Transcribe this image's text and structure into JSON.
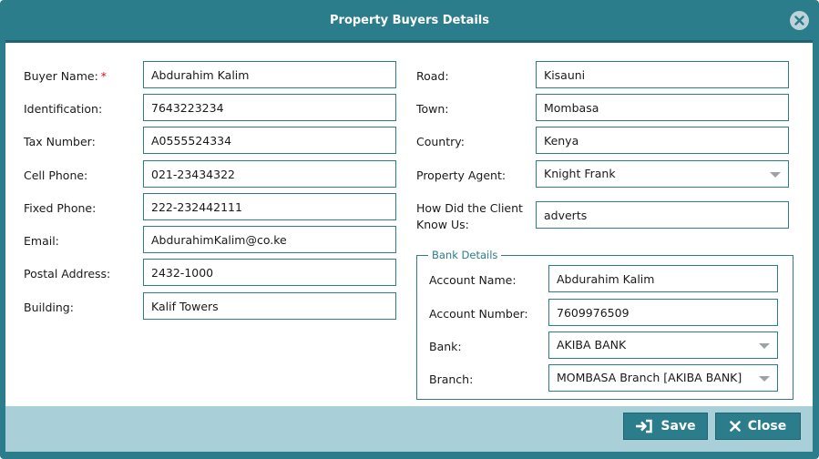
{
  "dialog": {
    "title": "Property Buyers Details",
    "close_icon": "close-circle-icon"
  },
  "left": {
    "buyer_name": {
      "label": "Buyer Name:",
      "required_mark": "*",
      "value": "Abdurahim Kalim"
    },
    "identification": {
      "label": "Identification:",
      "value": "7643223234"
    },
    "tax_number": {
      "label": "Tax Number:",
      "value": "A0555524334"
    },
    "cell_phone": {
      "label": "Cell Phone:",
      "value": "021-23434322"
    },
    "fixed_phone": {
      "label": "Fixed Phone:",
      "value": "222-232442111"
    },
    "email": {
      "label": "Email:",
      "value": "AbdurahimKalim@co.ke"
    },
    "postal_address": {
      "label": "Postal Address:",
      "value": "2432-1000"
    },
    "building": {
      "label": "Building:",
      "value": "Kalif Towers"
    }
  },
  "right": {
    "road": {
      "label": "Road:",
      "value": "Kisauni"
    },
    "town": {
      "label": "Town:",
      "value": "Mombasa"
    },
    "country": {
      "label": "Country:",
      "value": "Kenya"
    },
    "property_agent": {
      "label": "Property Agent:",
      "value": "Knight Frank"
    },
    "how_know": {
      "label_line1": "How Did the Client",
      "label_line2": "Know Us:",
      "value": "adverts"
    }
  },
  "bank": {
    "legend": "Bank Details",
    "account_name": {
      "label": "Account Name:",
      "value": "Abdurahim Kalim"
    },
    "account_number": {
      "label": "Account Number:",
      "value": "7609976509"
    },
    "bank": {
      "label": "Bank:",
      "value": "AKIBA BANK"
    },
    "branch": {
      "label": "Branch:",
      "value": "MOMBASA Branch [AKIBA BANK]"
    }
  },
  "footer": {
    "save_label": "Save",
    "save_icon": "sign-in-icon",
    "close_label": "Close",
    "close_icon": "x-icon"
  },
  "colors": {
    "primary": "#2c7d8c",
    "footer_bg": "#a9cfd8",
    "required": "#dd1111"
  }
}
